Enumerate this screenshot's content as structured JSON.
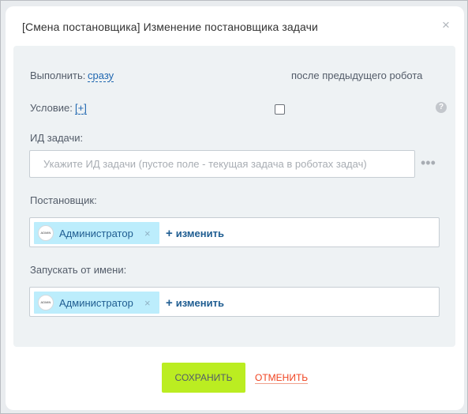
{
  "dialog": {
    "title": "[Смена постановщика] Изменение постановщика задачи"
  },
  "execute": {
    "label": "Выполнить:",
    "value": "сразу",
    "after_previous_label": "после предыдущего робота",
    "after_previous_checked": false,
    "help_glyph": "?"
  },
  "condition": {
    "label": "Условие:",
    "add": "[+]"
  },
  "task_id": {
    "label": "ИД задачи:",
    "placeholder": "Укажите ИД задачи (пустое поле - текущая задача в роботах задач)",
    "value": "",
    "more_glyph": "•••"
  },
  "creator": {
    "label": "Постановщик:",
    "user_name": "Администратор",
    "change_label": "изменить"
  },
  "run_as": {
    "label": "Запускать от имени:",
    "user_name": "Администратор",
    "change_label": "изменить"
  },
  "buttons": {
    "save": "СОХРАНИТЬ",
    "cancel": "ОТМЕНИТЬ"
  },
  "colors": {
    "accent_green": "#bbed21",
    "link_blue": "#2067b0",
    "cancel_red": "#f0421f",
    "tag_bg": "#bcedfc",
    "panel_bg": "#eef2f4"
  }
}
